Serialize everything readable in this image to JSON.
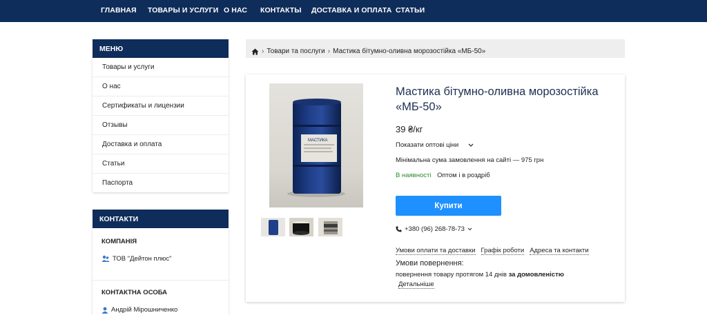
{
  "topnav": {
    "items": [
      "ГЛАВНАЯ",
      "ТОВАРЫ И УСЛУГИ",
      "О НАС",
      "КОНТАКТЫ",
      "ДОСТАВКА И ОПЛАТА",
      "СТАТЬИ"
    ]
  },
  "sidebar": {
    "menu_title": "МЕНЮ",
    "menu_items": [
      "Товары и услуги",
      "О нас",
      "Сертификаты и лицензии",
      "Отзывы",
      "Доставка и оплата",
      "Статьи",
      "Паспорта"
    ],
    "contacts_title": "КОНТАКТИ",
    "company_label": "КОМПАНІЯ",
    "company_name": "ТОВ \"Дейтон плюс\"",
    "person_label": "КОНТАКТНА ОСОБА",
    "person_name": "Андрій Мірошниченко"
  },
  "breadcrumb": {
    "items": [
      "Товари та послуги",
      "Мастика бітумно-оливна морозостійка «МБ-50»"
    ],
    "separator": "›"
  },
  "product": {
    "title": "Мастика бітумно-оливна морозостійка «МБ-50»",
    "price": "39 ₴/кг",
    "wholesale_toggle": "Показати оптові ціни",
    "min_order": "Мінімальна сума замовлення на сайті — 975 грн",
    "availability": "В наявності",
    "sale_type": "Оптом і в роздріб",
    "buy_label": "Купити",
    "phone": "+380 (96) 268-78-73",
    "links": [
      "Умови оплати та доставки",
      "Графік роботи",
      "Адреса та контакти"
    ],
    "return_title": "Умови повернення:",
    "return_text": "повернення товару протягом 14 днів",
    "return_text_bold": "за домовленістю",
    "details_label": "Детальніше",
    "drum_label": "МАСТИКА"
  },
  "colors": {
    "nav_bg": "#0f2d5a",
    "accent": "#1e90ff",
    "in_stock": "#2a8a2a"
  }
}
